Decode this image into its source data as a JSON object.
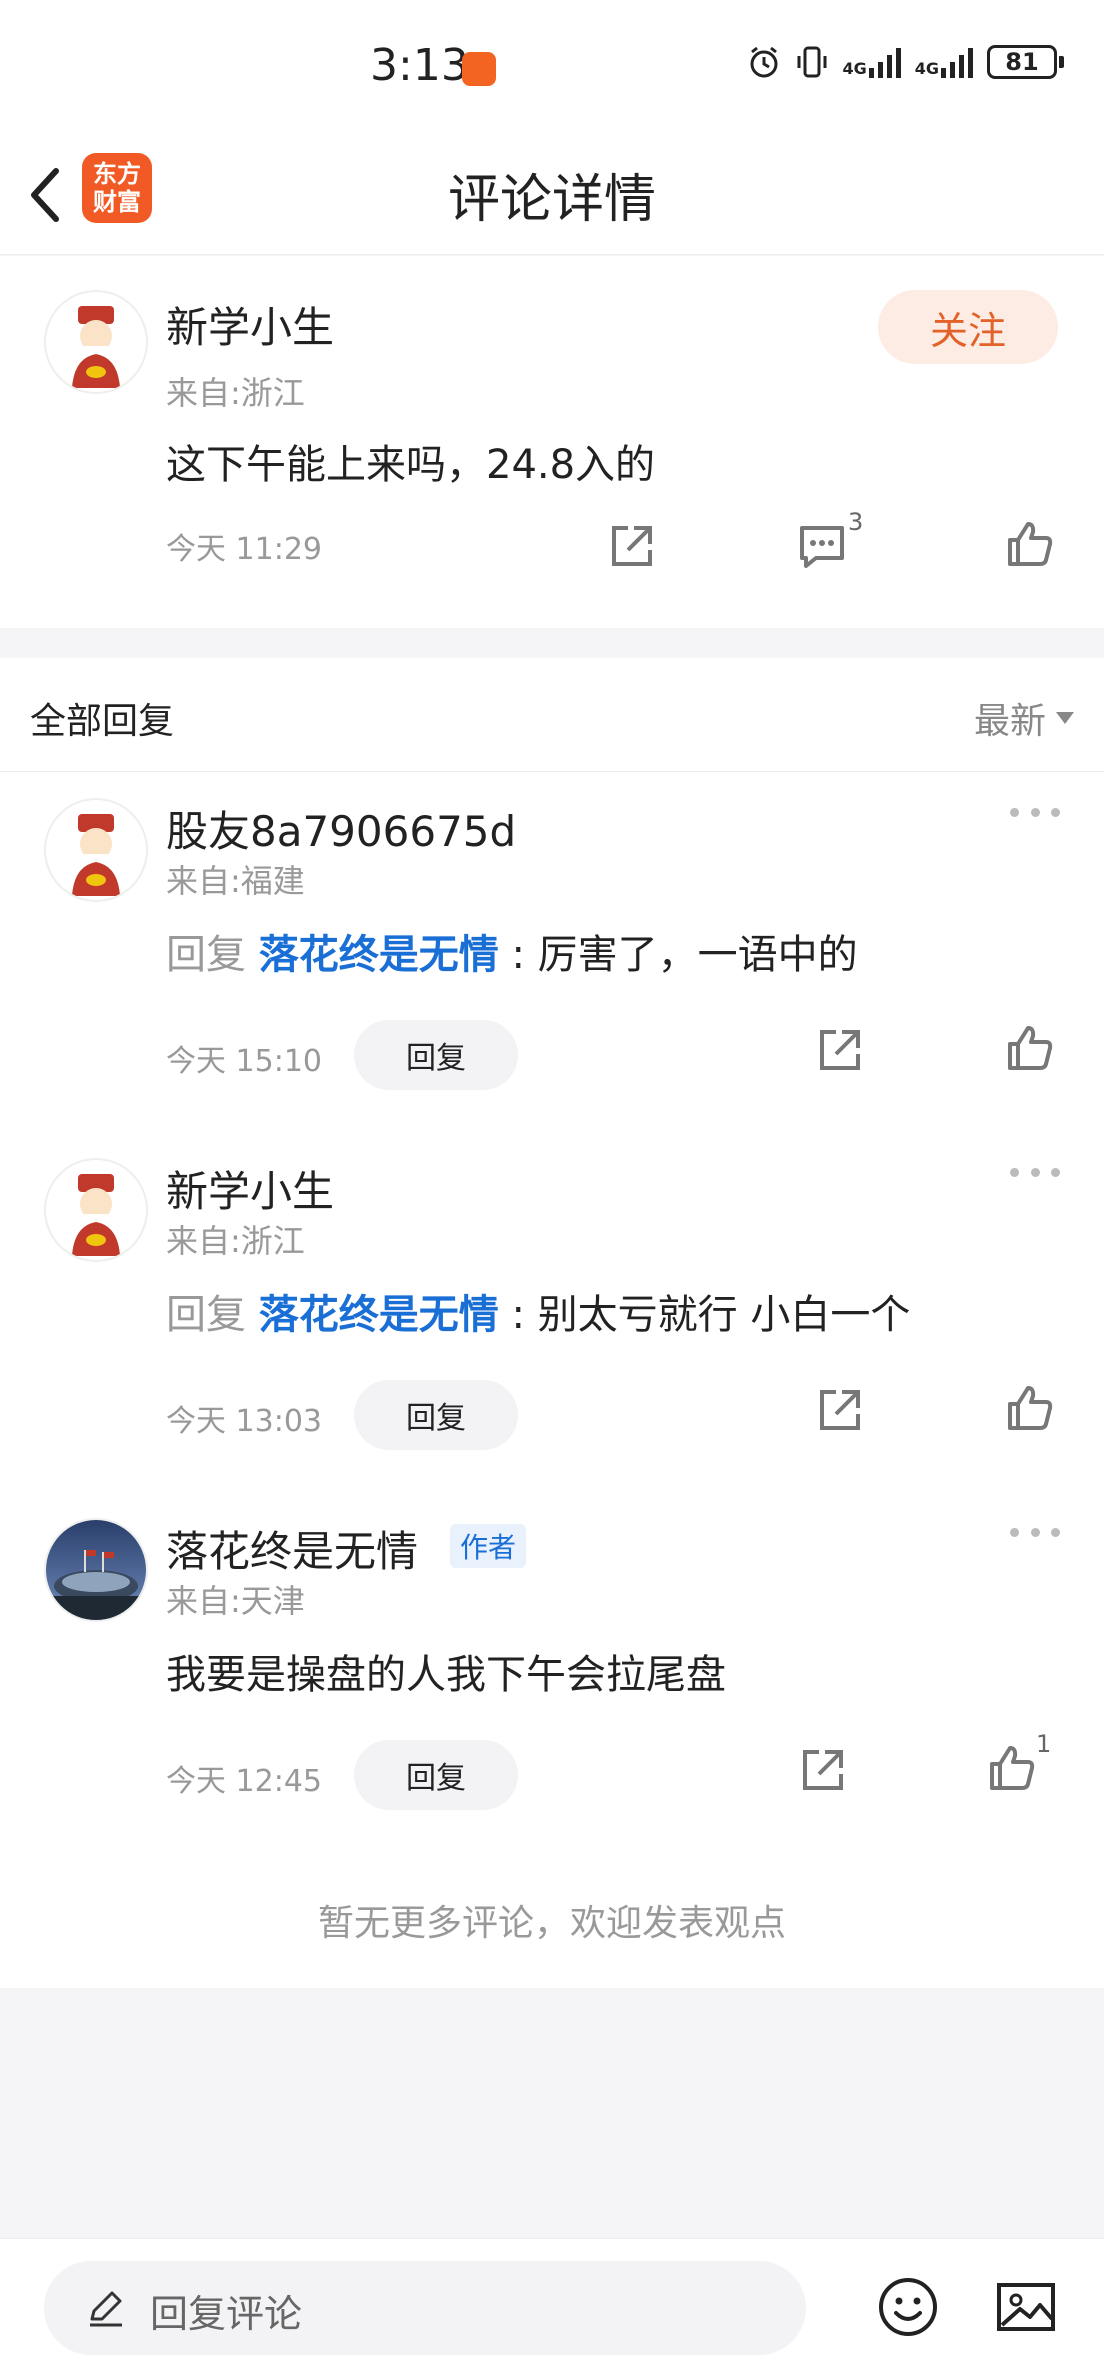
{
  "status_bar": {
    "time": "3:13",
    "signal1": "4G",
    "signal2": "4G",
    "battery": "81"
  },
  "nav": {
    "title": "评论详情",
    "logo_line1": "东方",
    "logo_line2": "财富"
  },
  "main_comment": {
    "username": "新学小生",
    "location": "来自:浙江",
    "content": "这下午能上来吗，24.8入的",
    "timestamp": "今天 11:29",
    "follow_label": "关注",
    "comment_count": "3"
  },
  "replies": {
    "header_label": "全部回复",
    "sort_label": "最新",
    "reply_button_label": "回复",
    "reply_prefix": "回复",
    "author_badge": "作者",
    "items": [
      {
        "username": "股友8a7906675d",
        "location": "来自:福建",
        "target": "落花终是无情",
        "text": ": 厉害了，一语中的",
        "timestamp": "今天 15:10",
        "like_count": ""
      },
      {
        "username": "新学小生",
        "location": "来自:浙江",
        "target": "落花终是无情",
        "text": ": 别太亏就行 小白一个",
        "timestamp": "今天 13:03",
        "like_count": ""
      },
      {
        "username": "落花终是无情",
        "location": "来自:天津",
        "content": "我要是操盘的人我下午会拉尾盘",
        "timestamp": "今天 12:45",
        "like_count": "1"
      }
    ],
    "no_more": "暂无更多评论，欢迎发表观点"
  },
  "bottom_bar": {
    "placeholder": "回复评论"
  },
  "colors": {
    "brand": "#f15a24",
    "link": "#1a6fd6",
    "follow_bg": "#fdece4",
    "follow_text": "#e2622a"
  }
}
